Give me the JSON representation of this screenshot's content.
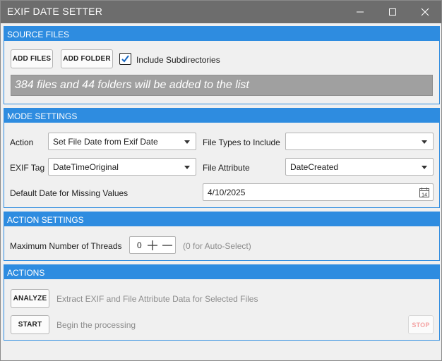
{
  "window": {
    "title": "EXIF DATE SETTER"
  },
  "source_files": {
    "header": "SOURCE FILES",
    "add_files_label": "ADD FILES",
    "add_folder_label": "ADD FOLDER",
    "include_subdirectories_label": "Include Subdirectories",
    "include_subdirectories_checked": true,
    "status_message": "384 files and 44 folders will be added to the list"
  },
  "mode_settings": {
    "header": "MODE SETTINGS",
    "action_label": "Action",
    "action_value": "Set File Date from Exif Date",
    "file_types_label": "File Types to Include",
    "file_types_value": "",
    "exif_tag_label": "EXIF Tag",
    "exif_tag_value": "DateTimeOriginal",
    "file_attribute_label": "File Attribute",
    "file_attribute_value": "DateCreated",
    "default_date_label": "Default Date for Missing Values",
    "default_date_value": "4/10/2025"
  },
  "action_settings": {
    "header": "ACTION SETTINGS",
    "threads_label": "Maximum Number of Threads",
    "threads_value": "0",
    "threads_hint": "(0 for Auto-Select)"
  },
  "actions": {
    "header": "ACTIONS",
    "analyze_label": "ANALYZE",
    "analyze_hint": "Extract EXIF and File Attribute Data for Selected Files",
    "start_label": "START",
    "start_hint": "Begin the processing",
    "stop_label": "STOP"
  },
  "colors": {
    "accent": "#2e8ce0",
    "titlebar": "#6d6d6d",
    "banner": "#a0a0a0",
    "stop_disabled": "#f4a3a3"
  }
}
